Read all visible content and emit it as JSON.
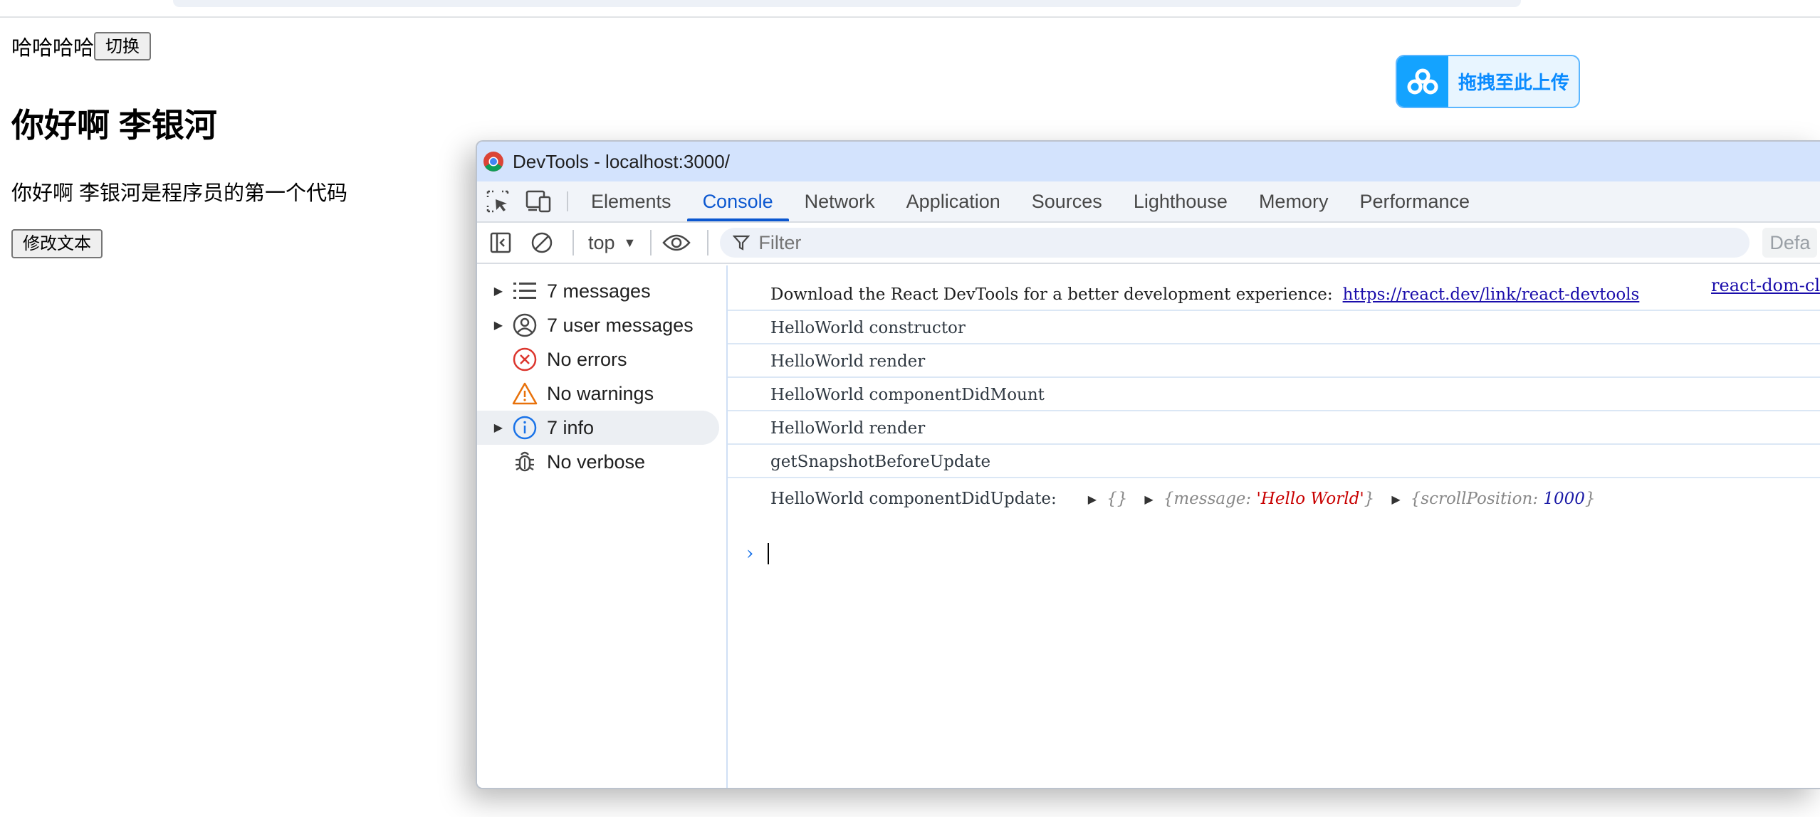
{
  "page": {
    "line1_text": "哈哈哈哈",
    "toggle_button": "切换",
    "title": "你好啊 李银河",
    "paragraph": "你好啊 李银河是程序员的第一个代码",
    "modify_button": "修改文本"
  },
  "upload_widget": {
    "label": "拖拽至此上传"
  },
  "devtools": {
    "window_title": "DevTools - localhost:3000/",
    "tabs": [
      {
        "label": "Elements"
      },
      {
        "label": "Console",
        "active": true
      },
      {
        "label": "Network"
      },
      {
        "label": "Application"
      },
      {
        "label": "Sources"
      },
      {
        "label": "Lighthouse"
      },
      {
        "label": "Memory"
      },
      {
        "label": "Performance"
      }
    ],
    "toolbar": {
      "context": "top",
      "filter_placeholder": "Filter",
      "levels_label": "Defa"
    },
    "sidebar": [
      {
        "label": "7 messages",
        "icon": "list-icon",
        "expandable": true
      },
      {
        "label": "7 user messages",
        "icon": "user-icon",
        "expandable": true
      },
      {
        "label": "No errors",
        "icon": "error-icon",
        "expandable": false
      },
      {
        "label": "No warnings",
        "icon": "warning-icon",
        "expandable": false
      },
      {
        "label": "7 info",
        "icon": "info-icon",
        "expandable": true,
        "selected": true
      },
      {
        "label": "No verbose",
        "icon": "bug-icon",
        "expandable": false
      }
    ],
    "console": {
      "source_link": "react-dom-cl",
      "first_message_text": "Download the React DevTools for a better development experience:",
      "first_message_link": "https://react.dev/link/react-devtools",
      "messages": [
        "HelloWorld constructor",
        "HelloWorld render",
        "HelloWorld componentDidMount",
        "HelloWorld render",
        "getSnapshotBeforeUpdate"
      ],
      "last_message": {
        "text": "HelloWorld componentDidUpdate:",
        "obj1": "{}",
        "obj2_key": "message",
        "obj2_value": "'Hello World'",
        "obj3_key": "scrollPosition",
        "obj3_value": "1000"
      }
    }
  },
  "colors": {
    "accent": "#0b57d0",
    "titlebar": "#d3e3fd",
    "link": "#1a0dab",
    "string": "#c80000",
    "number": "#1a1aa6",
    "upload_blue": "#14a3ff"
  }
}
